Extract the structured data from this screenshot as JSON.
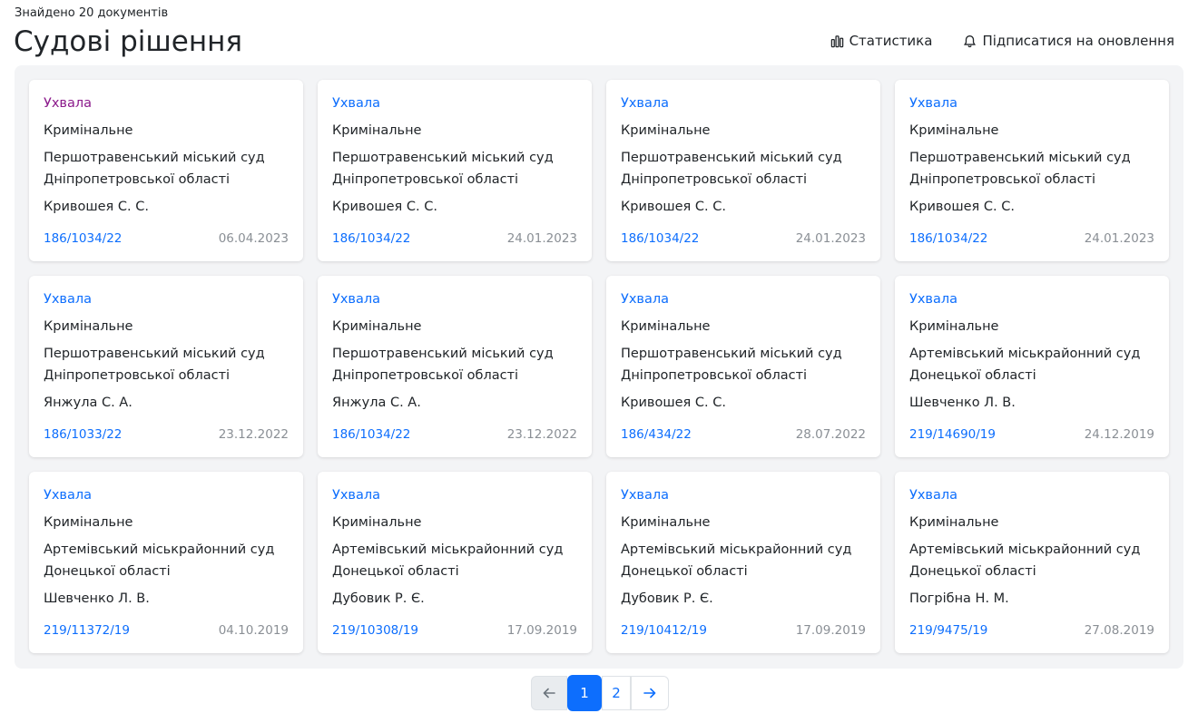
{
  "header": {
    "found_text": "Знайдено 20 документів",
    "title": "Судові рішення",
    "stats_label": "Статистика",
    "subscribe_label": "Підписатися на оновлення"
  },
  "cards": [
    {
      "type": "Ухвала",
      "category": "Кримінальне",
      "court": "Першотравенський міський суд Дніпропетровської області",
      "judge": "Кривошея С. С.",
      "case_number": "186/1034/22",
      "date": "06.04.2023"
    },
    {
      "type": "Ухвала",
      "category": "Кримінальне",
      "court": "Першотравенський міський суд Дніпропетровської області",
      "judge": "Кривошея С. С.",
      "case_number": "186/1034/22",
      "date": "24.01.2023"
    },
    {
      "type": "Ухвала",
      "category": "Кримінальне",
      "court": "Першотравенський міський суд Дніпропетровської області",
      "judge": "Кривошея С. С.",
      "case_number": "186/1034/22",
      "date": "24.01.2023"
    },
    {
      "type": "Ухвала",
      "category": "Кримінальне",
      "court": "Першотравенський міський суд Дніпропетровської області",
      "judge": "Кривошея С. С.",
      "case_number": "186/1034/22",
      "date": "24.01.2023"
    },
    {
      "type": "Ухвала",
      "category": "Кримінальне",
      "court": "Першотравенський міський суд Дніпропетровської області",
      "judge": "Янжула С. А.",
      "case_number": "186/1033/22",
      "date": "23.12.2022"
    },
    {
      "type": "Ухвала",
      "category": "Кримінальне",
      "court": "Першотравенський міський суд Дніпропетровської області",
      "judge": "Янжула С. А.",
      "case_number": "186/1034/22",
      "date": "23.12.2022"
    },
    {
      "type": "Ухвала",
      "category": "Кримінальне",
      "court": "Першотравенський міський суд Дніпропетровської області",
      "judge": "Кривошея С. С.",
      "case_number": "186/434/22",
      "date": "28.07.2022"
    },
    {
      "type": "Ухвала",
      "category": "Кримінальне",
      "court": "Артемівський міськрайонний суд Донецької області",
      "judge": "Шевченко Л. В.",
      "case_number": "219/14690/19",
      "date": "24.12.2019"
    },
    {
      "type": "Ухвала",
      "category": "Кримінальне",
      "court": "Артемівський міськрайонний суд Донецької області",
      "judge": "Шевченко Л. В.",
      "case_number": "219/11372/19",
      "date": "04.10.2019"
    },
    {
      "type": "Ухвала",
      "category": "Кримінальне",
      "court": "Артемівський міськрайонний суд Донецької області",
      "judge": "Дубовик Р. Є.",
      "case_number": "219/10308/19",
      "date": "17.09.2019"
    },
    {
      "type": "Ухвала",
      "category": "Кримінальне",
      "court": "Артемівський міськрайонний суд Донецької області",
      "judge": "Дубовик Р. Є.",
      "case_number": "219/10412/19",
      "date": "17.09.2019"
    },
    {
      "type": "Ухвала",
      "category": "Кримінальне",
      "court": "Артемівський міськрайонний суд Донецької області",
      "judge": "Погрібна Н. М.",
      "case_number": "219/9475/19",
      "date": "27.08.2019"
    }
  ],
  "pagination": {
    "pages": [
      "1",
      "2"
    ],
    "current": "1",
    "prev_icon": "arrow-left-icon",
    "next_icon": "arrow-right-icon"
  },
  "colors": {
    "link": "#0d6efd",
    "visited_link": "#8b1a8b",
    "panel_bg": "#f3f4f6",
    "muted": "#8a8f95"
  }
}
